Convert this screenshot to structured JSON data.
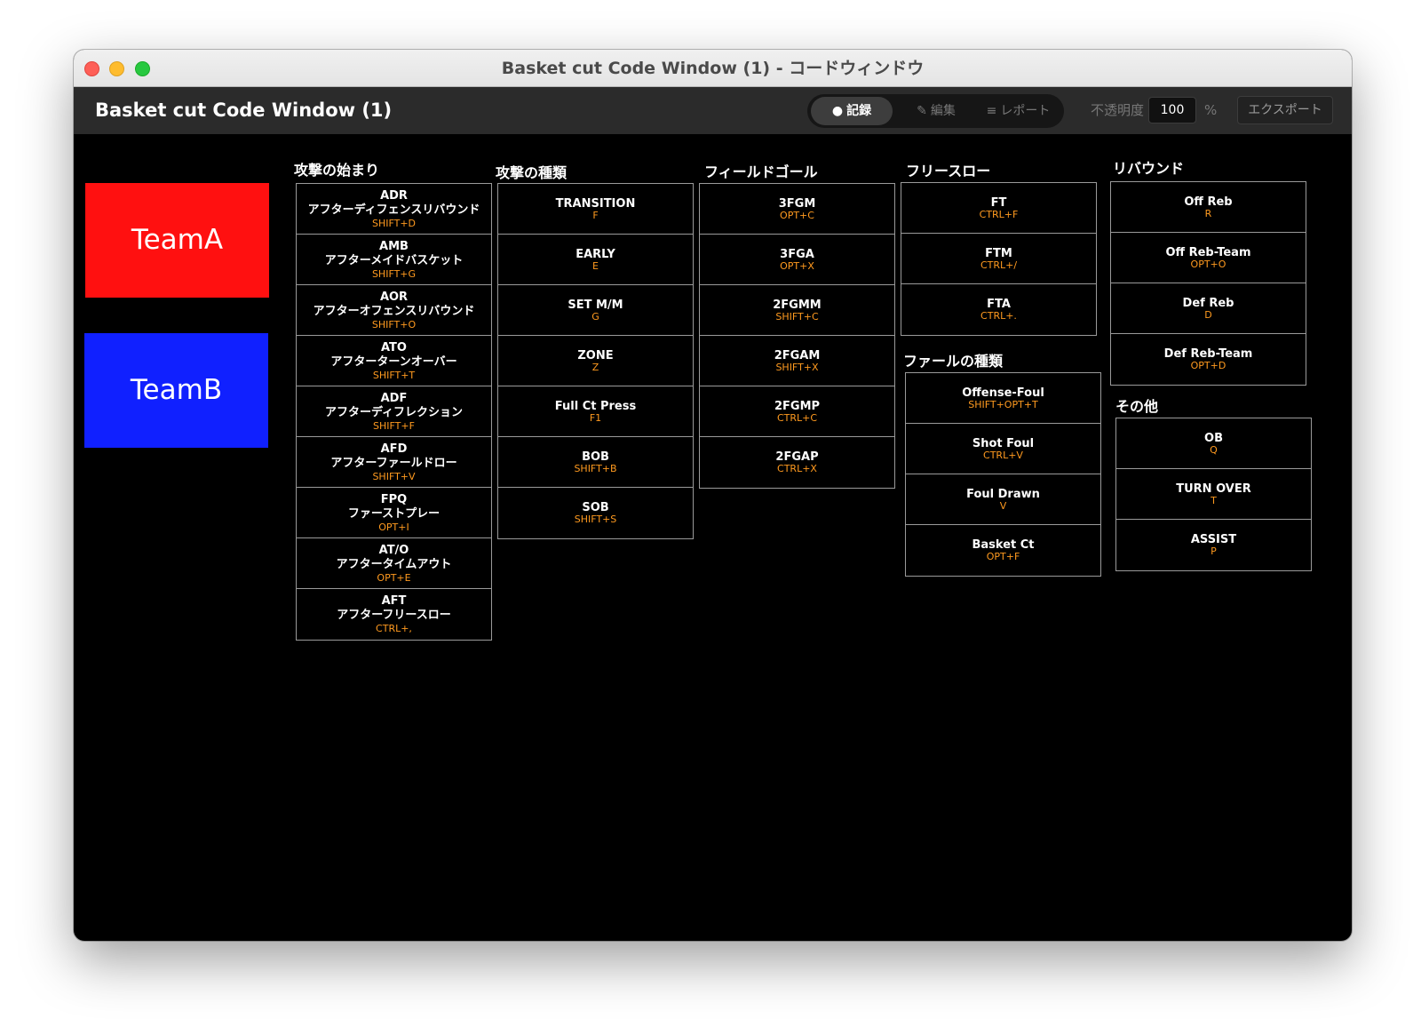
{
  "window": {
    "title": "Basket cut Code Window (1) - コードウィンドウ"
  },
  "toolbar": {
    "app_title": "Basket cut Code Window (1)",
    "modes": [
      {
        "icon": "●",
        "label": "記録"
      },
      {
        "icon": "✎",
        "label": "編集"
      },
      {
        "icon": "≡",
        "label": "レポート"
      }
    ],
    "active_mode": "記録",
    "opacity_label": "不透明度",
    "opacity_value": "100",
    "opacity_unit": "%",
    "export_label": "エクスポート"
  },
  "teams": {
    "team_a": {
      "label": "TeamA",
      "color": "#ff1010"
    },
    "team_b": {
      "label": "TeamB",
      "color": "#1020ff"
    }
  },
  "key_color": "#ff9a1f",
  "sections": {
    "attack_start": {
      "title": "攻撃の始まり",
      "items": [
        {
          "name": "ADR",
          "sub": "アフターディフェンスリバウンド",
          "key": "SHIFT+D"
        },
        {
          "name": "AMB",
          "sub": "アフターメイドバスケット",
          "key": "SHIFT+G"
        },
        {
          "name": "AOR",
          "sub": "アフターオフェンスリバウンド",
          "key": "SHIFT+O"
        },
        {
          "name": "ATO",
          "sub": "アフターターンオーバー",
          "key": "SHIFT+T"
        },
        {
          "name": "ADF",
          "sub": "アフターディフレクション",
          "key": "SHIFT+F"
        },
        {
          "name": "AFD",
          "sub": "アフターファールドロー",
          "key": "SHIFT+V"
        },
        {
          "name": "FPQ",
          "sub": "ファーストプレー",
          "key": "OPT+I"
        },
        {
          "name": "AT/O",
          "sub": "アフタータイムアウト",
          "key": "OPT+E"
        },
        {
          "name": "AFT",
          "sub": "アフターフリースロー",
          "key": "CTRL+,"
        }
      ]
    },
    "attack_type": {
      "title": "攻撃の種類",
      "items": [
        {
          "name": "TRANSITION",
          "key": "F"
        },
        {
          "name": "EARLY",
          "key": "E"
        },
        {
          "name": "SET M/M",
          "key": "G"
        },
        {
          "name": "ZONE",
          "key": "Z"
        },
        {
          "name": "Full Ct Press",
          "key": "F1"
        },
        {
          "name": "BOB",
          "key": "SHIFT+B"
        },
        {
          "name": "SOB",
          "key": "SHIFT+S"
        }
      ]
    },
    "field_goal": {
      "title": "フィールドゴール",
      "items": [
        {
          "name": "3FGM",
          "key": "OPT+C"
        },
        {
          "name": "3FGA",
          "key": "OPT+X"
        },
        {
          "name": "2FGMM",
          "key": "SHIFT+C"
        },
        {
          "name": "2FGAM",
          "key": "SHIFT+X"
        },
        {
          "name": "2FGMP",
          "key": "CTRL+C"
        },
        {
          "name": "2FGAP",
          "key": "CTRL+X"
        }
      ]
    },
    "free_throw": {
      "title": "フリースロー",
      "items": [
        {
          "name": "FT",
          "key": "CTRL+F"
        },
        {
          "name": "FTM",
          "key": "CTRL+/"
        },
        {
          "name": "FTA",
          "key": "CTRL+."
        }
      ]
    },
    "foul_type": {
      "title": "ファールの種類",
      "items": [
        {
          "name": "Offense-Foul",
          "key": "SHIFT+OPT+T"
        },
        {
          "name": "Shot Foul",
          "key": "CTRL+V"
        },
        {
          "name": "Foul Drawn",
          "key": "V"
        },
        {
          "name": "Basket Ct",
          "key": "OPT+F"
        }
      ]
    },
    "rebound": {
      "title": "リバウンド",
      "items": [
        {
          "name": "Off Reb",
          "key": "R"
        },
        {
          "name": "Off Reb-Team",
          "key": "OPT+O"
        },
        {
          "name": "Def Reb",
          "key": "D"
        },
        {
          "name": "Def Reb-Team",
          "key": "OPT+D"
        }
      ]
    },
    "other": {
      "title": "その他",
      "items": [
        {
          "name": "OB",
          "key": "Q"
        },
        {
          "name": "TURN OVER",
          "key": "T"
        },
        {
          "name": "ASSIST",
          "key": "P"
        }
      ]
    }
  }
}
